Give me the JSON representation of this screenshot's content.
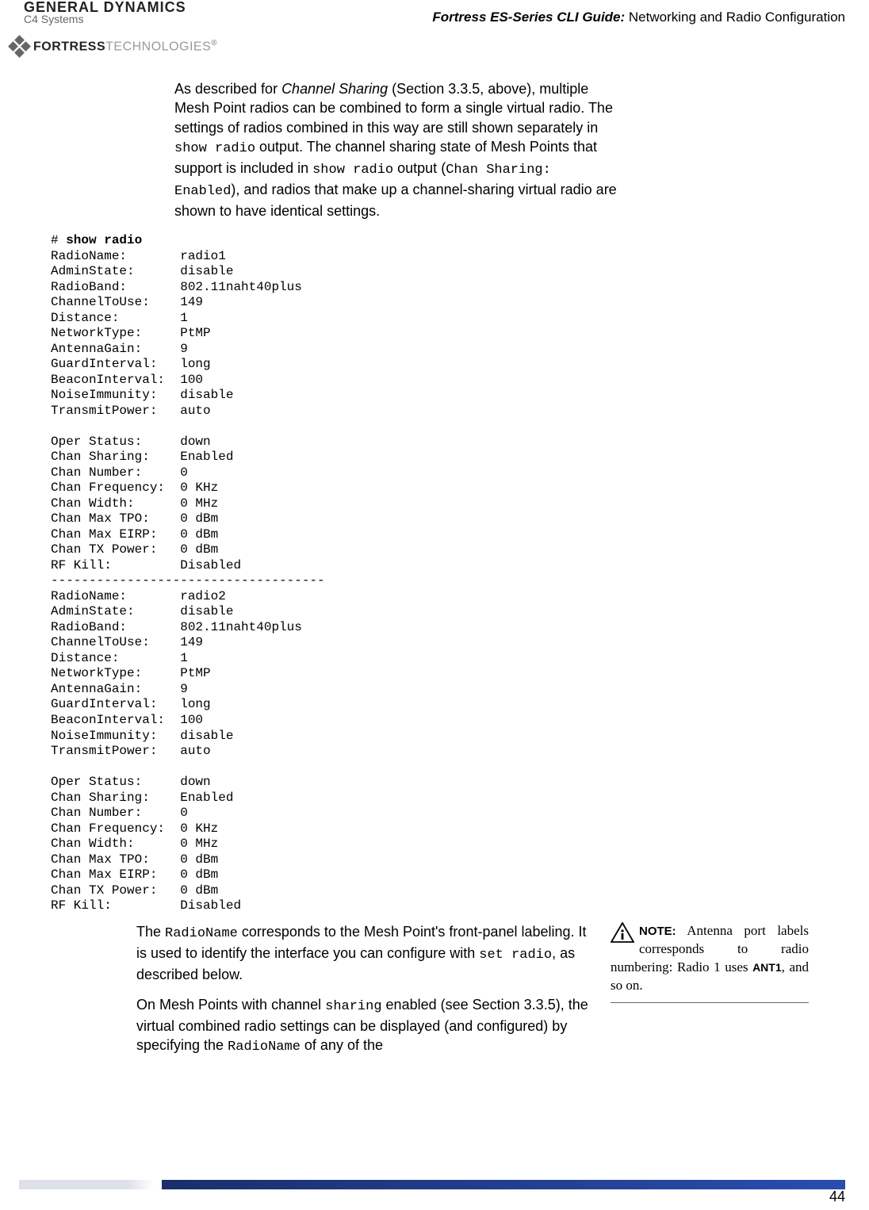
{
  "header": {
    "gd_top": "GENERAL DYNAMICS",
    "gd_sub": "C4 Systems",
    "doc_title_italic": "Fortress ES-Series CLI Guide:",
    "doc_title_rest": " Networking and Radio Configuration",
    "ft_bold": "FORTRESS",
    "ft_thin": "TECHNOLOGIES",
    "ft_reg": "®"
  },
  "para1": {
    "t1": "As described for ",
    "t2": "Channel Sharing",
    "t3": " (Section 3.3.5, above), multiple Mesh Point radios can be combined to form a single virtual radio. The settings of radios combined in this way are still shown separately in ",
    "m1": "show radio",
    "t4": " output. The channel sharing state of Mesh Points that support is included in ",
    "m2": "show radio",
    "t5": " output (",
    "m3": "Chan Sharing: Enabled",
    "t6": "), and radios that make up a channel-sharing virtual radio are shown to have identical settings."
  },
  "cli": {
    "prompt": "# ",
    "cmd": "show radio",
    "radios": [
      {
        "RadioName": "radio1",
        "AdminState": "disable",
        "RadioBand": "802.11naht40plus",
        "ChannelToUse": "149",
        "Distance": "1",
        "NetworkType": "PtMP",
        "AntennaGain": "9",
        "GuardInterval": "long",
        "BeaconInterval": "100",
        "NoiseImmunity": "disable",
        "TransmitPower": "auto",
        "OperStatus": "down",
        "ChanSharing": "Enabled",
        "ChanNumber": "0",
        "ChanFrequency": "0 KHz",
        "ChanWidth": "0 MHz",
        "ChanMaxTPO": "0 dBm",
        "ChanMaxEIRP": "0 dBm",
        "ChanTXPower": "0 dBm",
        "RFKill": "Disabled"
      },
      {
        "RadioName": "radio2",
        "AdminState": "disable",
        "RadioBand": "802.11naht40plus",
        "ChannelToUse": "149",
        "Distance": "1",
        "NetworkType": "PtMP",
        "AntennaGain": "9",
        "GuardInterval": "long",
        "BeaconInterval": "100",
        "NoiseImmunity": "disable",
        "TransmitPower": "auto",
        "OperStatus": "down",
        "ChanSharing": "Enabled",
        "ChanNumber": "0",
        "ChanFrequency": "0 KHz",
        "ChanWidth": "0 MHz",
        "ChanMaxTPO": "0 dBm",
        "ChanMaxEIRP": "0 dBm",
        "ChanTXPower": "0 dBm",
        "RFKill": "Disabled"
      }
    ],
    "separator": "------------------------------------"
  },
  "para2": {
    "t1": "The ",
    "m1": "RadioName",
    "t2": " corresponds to the Mesh Point's front-panel labeling. It is used to identify the interface you can configure with ",
    "m2": "set radio",
    "t3": ", as described below."
  },
  "para3": {
    "t1": "On Mesh Points with channel ",
    "m1": "sharing",
    "t2": " enabled (see Section 3.3.5), the virtual combined radio settings can be displayed (and configured) by specifying the ",
    "m2": "RadioName",
    "t3": " of any of the"
  },
  "note": {
    "label": "NOTE:",
    "body1": " Antenna port labels corresponds to radio numbering: Radio 1 uses ",
    "ant1": "ANT1",
    "body2": ", and so on."
  },
  "page_number": "44"
}
